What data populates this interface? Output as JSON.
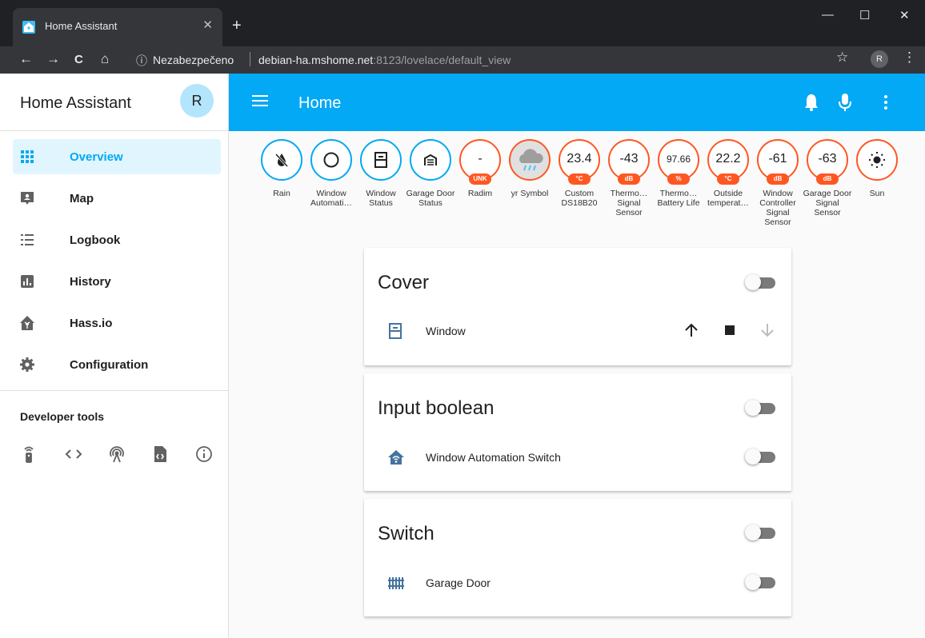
{
  "browser": {
    "tab_title": "Home Assistant",
    "tab_close": "✕",
    "new_tab": "+",
    "win_min": "—",
    "win_max": "☐",
    "win_close": "✕",
    "back": "←",
    "forward": "→",
    "reload": "C",
    "home": "⌂",
    "info_icon": "ⓘ",
    "security_text": "Nezabezpečeno",
    "url_host": "debian-ha.mshome.net",
    "url_path": ":8123/lovelace/default_view",
    "star": "☆",
    "profile": "R",
    "menu": "⋮"
  },
  "sidebar": {
    "title": "Home Assistant",
    "avatar": "R",
    "items": [
      {
        "label": "Overview",
        "icon": "view-grid-icon",
        "active": true
      },
      {
        "label": "Map",
        "icon": "map-marker-icon"
      },
      {
        "label": "Logbook",
        "icon": "logbook-icon"
      },
      {
        "label": "History",
        "icon": "chart-icon"
      },
      {
        "label": "Hass.io",
        "icon": "hassio-icon"
      },
      {
        "label": "Configuration",
        "icon": "gear-icon"
      }
    ],
    "developer_tools_title": "Developer tools",
    "developer_tools": [
      "remote-icon",
      "code-icon",
      "radio-tower-icon",
      "file-code-icon",
      "info-icon"
    ]
  },
  "appbar": {
    "title": "Home",
    "colors": {
      "primary": "#03a9f4",
      "accent": "#ff5722"
    }
  },
  "badges": [
    {
      "label": "Rain",
      "icon": "water-off-icon"
    },
    {
      "label": "Window Automati…",
      "icon": "circle-outline-icon"
    },
    {
      "label": "Window Status",
      "icon": "window-icon"
    },
    {
      "label": "Garage Door Status",
      "icon": "garage-icon"
    },
    {
      "label": "Radim",
      "value": "-",
      "unit": "UNK"
    },
    {
      "label": "yr Symbol",
      "icon": "cloud-rain-picture"
    },
    {
      "label": "Custom DS18B20",
      "value": "23.4",
      "unit": "°C"
    },
    {
      "label": "Thermo… Signal Sensor",
      "value": "-43",
      "unit": "dB"
    },
    {
      "label": "Thermo… Battery Life",
      "value": "97.66",
      "unit": "%"
    },
    {
      "label": "Outside temperat…",
      "value": "22.2",
      "unit": "°C"
    },
    {
      "label": "Window Controller Signal Sensor",
      "value": "-61",
      "unit": "dB"
    },
    {
      "label": "Garage Door Signal Sensor",
      "value": "-63",
      "unit": "dB"
    },
    {
      "label": "Sun",
      "icon": "sun-icon"
    }
  ],
  "cards": {
    "cover": {
      "title": "Cover",
      "row_label": "Window",
      "toggle_on": false,
      "row_icon": "window-icon"
    },
    "input_boolean": {
      "title": "Input boolean",
      "row_label": "Window Automation Switch",
      "toggle_on": false,
      "row_icon": "home-automation-icon"
    },
    "switch": {
      "title": "Switch",
      "row_label": "Garage Door",
      "toggle_on": false,
      "row_icon": "gate-icon"
    }
  }
}
